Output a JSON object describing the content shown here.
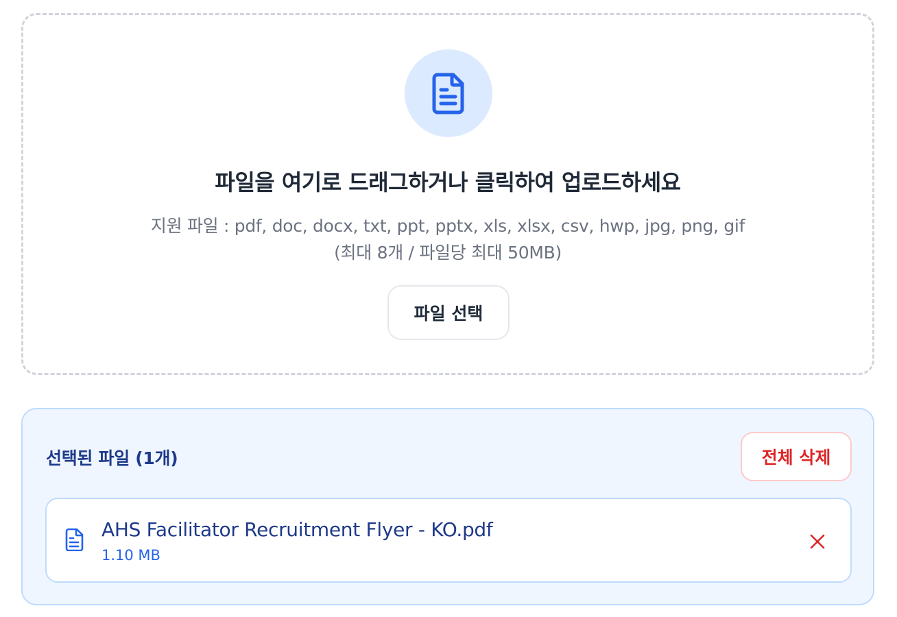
{
  "dropzone": {
    "title": "파일을 여기로 드래그하거나 클릭하여 업로드하세요",
    "supported": "지원 파일 : pdf, doc, docx, txt, ppt, pptx, xls, xlsx, csv, hwp, jpg, png, gif",
    "limits": "(최대 8개 / 파일당 최대 50MB)",
    "select_button": "파일 선택",
    "icon": "document-icon"
  },
  "files_panel": {
    "title": "선택된 파일 (1개)",
    "clear_button": "전체 삭제",
    "files": [
      {
        "name": "AHS Facilitator Recruitment Flyer - KO.pdf",
        "size": "1.10 MB",
        "icon": "document-icon"
      }
    ]
  },
  "colors": {
    "accent": "#2563eb",
    "accent_light": "#dbeafe",
    "panel_bg": "#eff6ff",
    "danger": "#dc2626"
  }
}
